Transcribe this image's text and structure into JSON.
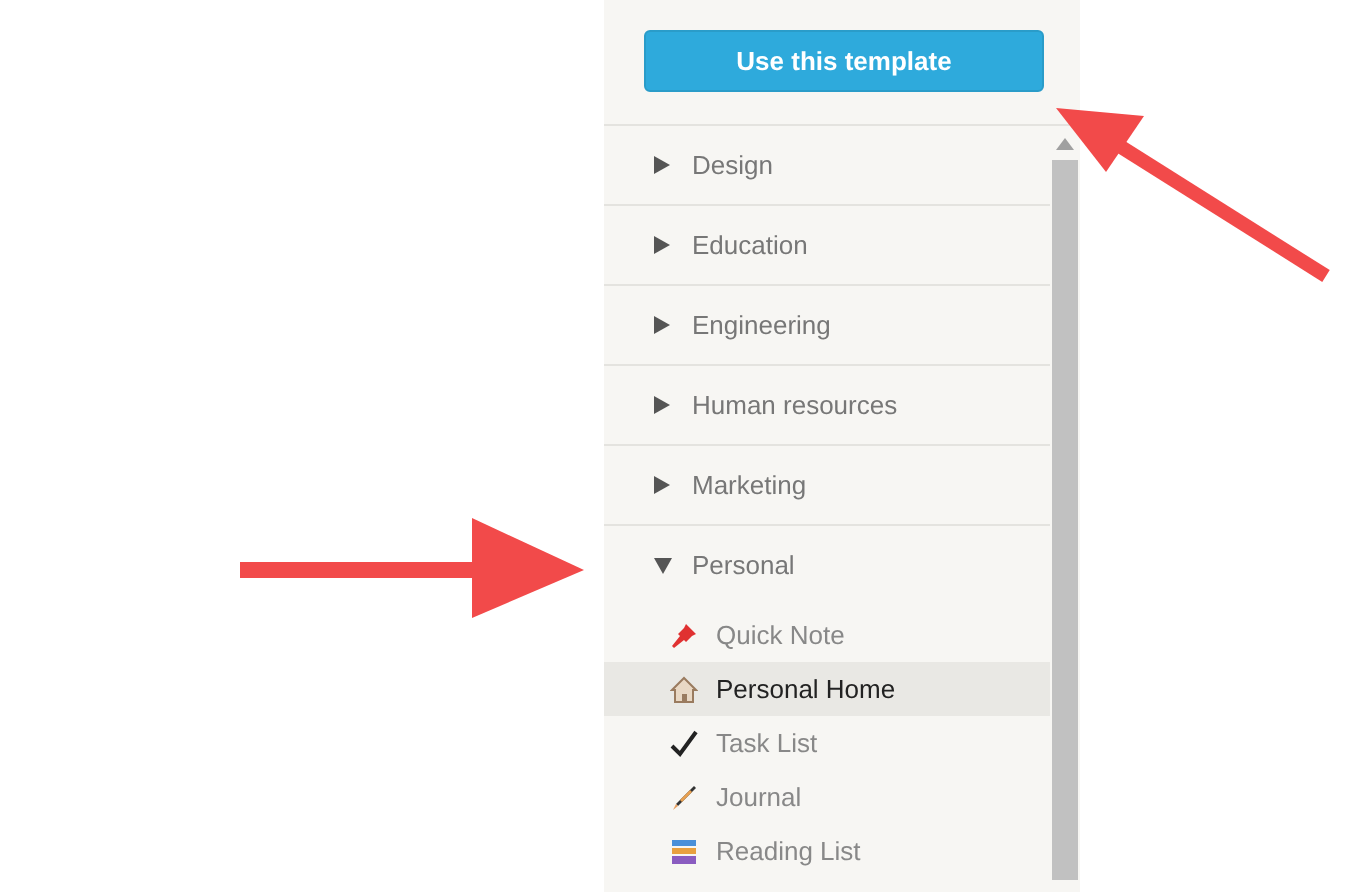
{
  "button": {
    "label": "Use this template"
  },
  "categories": [
    {
      "label": "Design",
      "expanded": false
    },
    {
      "label": "Education",
      "expanded": false
    },
    {
      "label": "Engineering",
      "expanded": false
    },
    {
      "label": "Human resources",
      "expanded": false
    },
    {
      "label": "Marketing",
      "expanded": false
    },
    {
      "label": "Personal",
      "expanded": true,
      "children": [
        {
          "label": "Quick Note",
          "kind": "pin",
          "selected": false
        },
        {
          "label": "Personal Home",
          "kind": "house",
          "selected": true
        },
        {
          "label": "Task List",
          "kind": "check",
          "selected": false
        },
        {
          "label": "Journal",
          "kind": "pen",
          "selected": false
        },
        {
          "label": "Reading List",
          "kind": "books",
          "selected": false
        }
      ]
    }
  ]
}
